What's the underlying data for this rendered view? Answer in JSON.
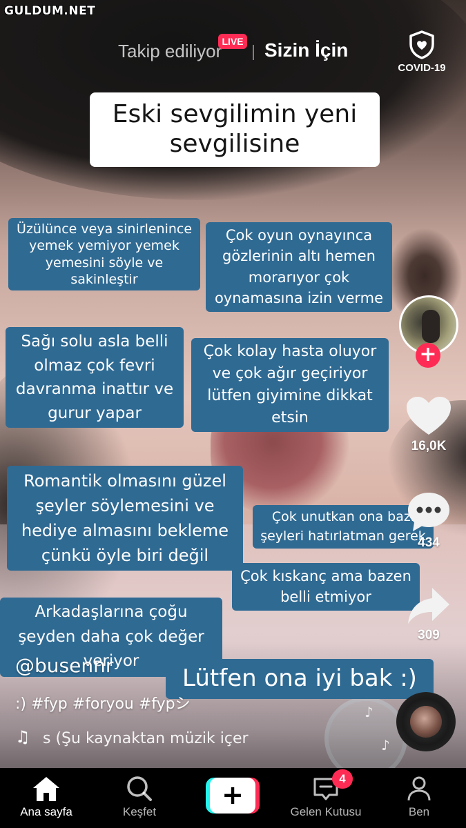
{
  "watermark": "GULDUM.NET",
  "top_nav": {
    "following_tab": "Takip ediliyor",
    "live_badge": "LIVE",
    "for_you_tab": "Sizin İçin",
    "covid_label": "COVID-19"
  },
  "video_captions": {
    "title_line1": "Eski sevgilimin yeni",
    "title_line2": "sevgilisine",
    "notes": [
      "Üzülünce veya sinirlenince yemek yemiyor yemek yemesini söyle ve sakinleştir",
      "Çok oyun oynayınca gözlerinin altı hemen morarıyor çok oynamasına izin verme",
      "Sağı solu asla belli olmaz çok fevri davranma inattır ve gurur yapar",
      "Çok kolay hasta oluyor ve çok ağır geçiriyor lütfen giyimine dikkat etsin",
      "Romantik olmasını güzel şeyler söylemesini ve hediye almasını bekleme çünkü öyle biri değil",
      "Çok unutkan ona bazı şeyleri hatırlatman gerek",
      "Çok kıskanç ama bazen belli etmiyor",
      "Arkadaşlarına çoğu şeyden daha çok değer veriyor",
      "Lütfen ona iyi bak :)"
    ]
  },
  "actions": {
    "follow_plus": "+",
    "like_count": "16,0K",
    "comment_count": "434",
    "share_count": "309"
  },
  "post_info": {
    "username": "@busennr",
    "description": ":) #fyp #foryou #fypシ",
    "music": "s (Şu kaynaktan müzik içer"
  },
  "bottom_bar": {
    "home": "Ana sayfa",
    "discover": "Keşfet",
    "create": "+",
    "inbox": "Gelen Kutusu",
    "inbox_badge": "4",
    "me": "Ben"
  },
  "colors": {
    "accent_red": "#fe2c55",
    "accent_cyan": "#25f4ee",
    "caption_blue": "#2f6a93"
  },
  "icons": [
    "shield-heart-icon",
    "heart-icon",
    "comment-icon",
    "share-icon",
    "music-note-icon",
    "home-icon",
    "search-icon",
    "inbox-icon",
    "profile-icon"
  ]
}
